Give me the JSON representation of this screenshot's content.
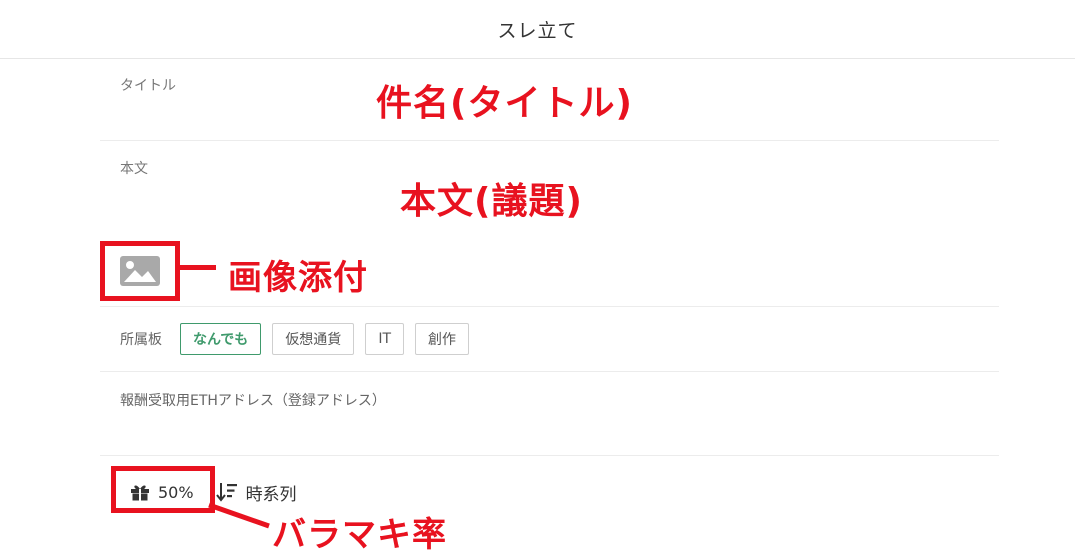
{
  "header": {
    "title": "スレ立て"
  },
  "form": {
    "title_label": "タイトル",
    "body_label": "本文",
    "board_label": "所属板",
    "boards": [
      {
        "label": "なんでも",
        "selected": true
      },
      {
        "label": "仮想通貨",
        "selected": false
      },
      {
        "label": "IT",
        "selected": false
      },
      {
        "label": "創作",
        "selected": false
      }
    ],
    "eth_label": "報酬受取用ETHアドレス（登録アドレス）",
    "reward_rate": "50%",
    "sort_label": "時系列"
  },
  "annotations": {
    "title": "件名(タイトル)",
    "body": "本文(議題)",
    "image": "画像添付",
    "reward": "バラマキ率"
  },
  "icons": {
    "image": "image-icon",
    "gift": "gift-icon",
    "sort": "sort-descending-icon"
  },
  "colors": {
    "accent_green": "#3f9a6c",
    "annotation_red": "#e8121f"
  }
}
